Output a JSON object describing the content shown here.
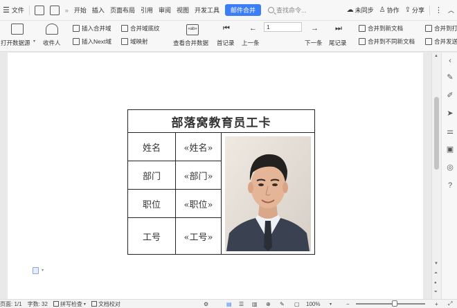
{
  "menubar": {
    "file": "文件",
    "tabs": [
      "开始",
      "插入",
      "页面布局",
      "引用",
      "审阅",
      "视图",
      "开发工具"
    ],
    "active_tab": "邮件合并",
    "search_placeholder": "查找命令...",
    "sync": "未同步",
    "collab": "协作",
    "share": "分享"
  },
  "ribbon": {
    "open_datasource": "打开数据源",
    "recipients": "收件人",
    "insert_merge_field": "插入合并域",
    "merge_field_shading": "合并域底纹",
    "insert_next_field": "插入Next域",
    "field_mapping": "域映射",
    "view_merged_data": "查看合并数据",
    "first_record": "首记录",
    "prev": "上一条",
    "page_value": "1",
    "next": "下一条",
    "last_record": "尾记录",
    "merge_to_new_doc": "合并到新文档",
    "merge_to_different_docs": "合并到不同新文档",
    "merge_print": "合并到打",
    "merge_send": "合并发送"
  },
  "card": {
    "title": "部落窝教育员工卡",
    "rows": [
      {
        "label": "姓名",
        "field": "«姓名»"
      },
      {
        "label": "部门",
        "field": "«部门»"
      },
      {
        "label": "职位",
        "field": "«职位»"
      },
      {
        "label": "工号",
        "field": "«工号»"
      }
    ]
  },
  "statusbar": {
    "page": "页面: 1/1",
    "words": "字数: 32",
    "spellcheck": "拼写检查",
    "doc_check": "文档校对",
    "zoom": "100%"
  },
  "colors": {
    "accent": "#3c7ef6",
    "page_bg": "#ffffff",
    "workspace_bg": "#e9e9ea"
  }
}
